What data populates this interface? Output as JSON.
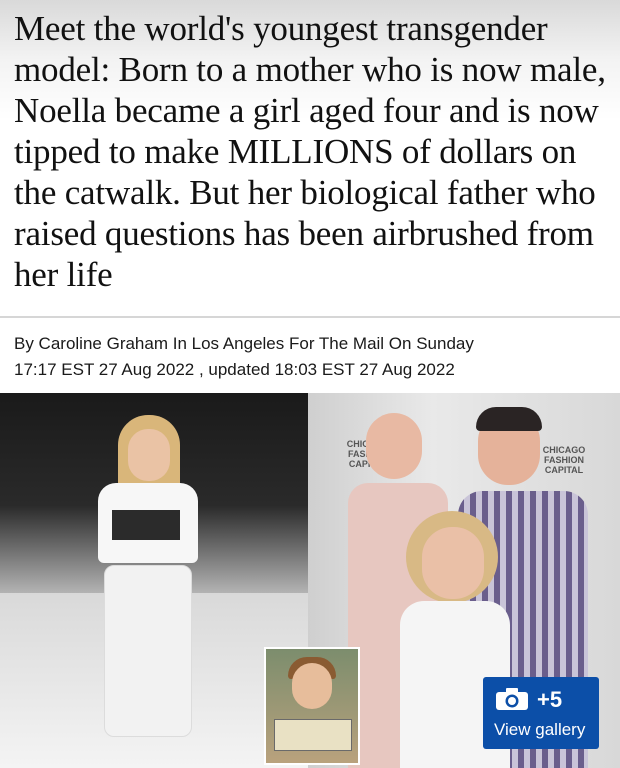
{
  "article": {
    "headline": "Meet the world's youngest transgender model: Born to a mother who is now male, Noella became a girl aged four and is now tipped to make MILLIONS of dollars on the catwalk. But her biological father who raised questions has been airbrushed from her life",
    "byline": "By Caroline Graham In Los Angeles For The Mail On Sunday",
    "timestamp": "17:17 EST 27 Aug 2022 , updated 18:03 EST 27 Aug 2022"
  },
  "media": {
    "backdrop_text_left": "CHICAGO FASHION CAPITAL",
    "backdrop_text_right": "CHICAGO FASHION CAPITAL",
    "gallery_count": "+5",
    "gallery_label": "View gallery",
    "camera_icon": "camera-icon",
    "next_icon": "chevron-right-icon"
  },
  "colors": {
    "gallery_button": "#0c4fa8",
    "headline_text": "#111111"
  }
}
